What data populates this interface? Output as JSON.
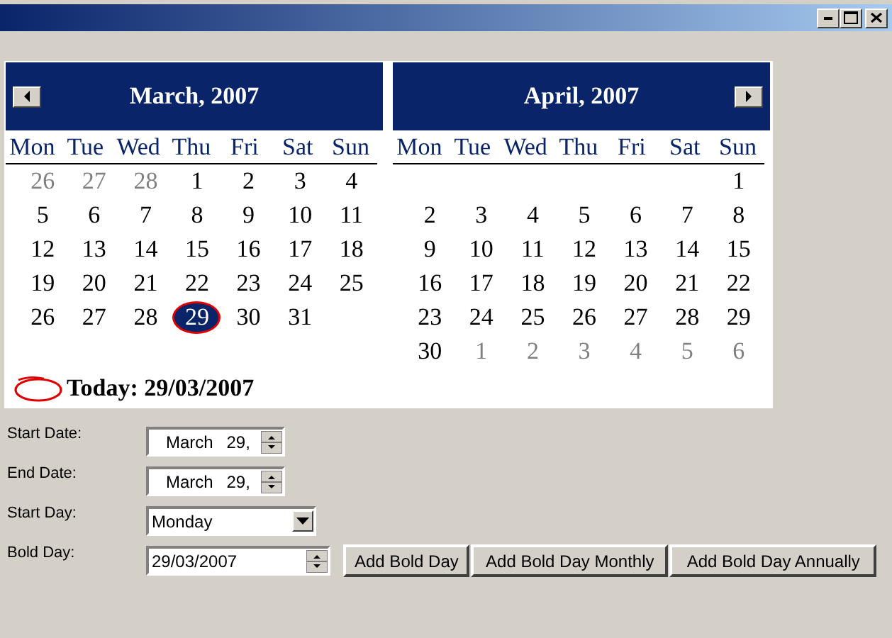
{
  "calendar": {
    "months": [
      {
        "title": "March, 2007",
        "weekdays": [
          "Mon",
          "Tue",
          "Wed",
          "Thu",
          "Fri",
          "Sat",
          "Sun"
        ],
        "weeks": [
          [
            {
              "day": "26",
              "other_month": true,
              "selected": false
            },
            {
              "day": "27",
              "other_month": true,
              "selected": false
            },
            {
              "day": "28",
              "other_month": true,
              "selected": false
            },
            {
              "day": "1",
              "other_month": false,
              "selected": false
            },
            {
              "day": "2",
              "other_month": false,
              "selected": false
            },
            {
              "day": "3",
              "other_month": false,
              "selected": false
            },
            {
              "day": "4",
              "other_month": false,
              "selected": false
            }
          ],
          [
            {
              "day": "5",
              "other_month": false,
              "selected": false
            },
            {
              "day": "6",
              "other_month": false,
              "selected": false
            },
            {
              "day": "7",
              "other_month": false,
              "selected": false
            },
            {
              "day": "8",
              "other_month": false,
              "selected": false
            },
            {
              "day": "9",
              "other_month": false,
              "selected": false
            },
            {
              "day": "10",
              "other_month": false,
              "selected": false
            },
            {
              "day": "11",
              "other_month": false,
              "selected": false
            }
          ],
          [
            {
              "day": "12",
              "other_month": false,
              "selected": false
            },
            {
              "day": "13",
              "other_month": false,
              "selected": false
            },
            {
              "day": "14",
              "other_month": false,
              "selected": false
            },
            {
              "day": "15",
              "other_month": false,
              "selected": false
            },
            {
              "day": "16",
              "other_month": false,
              "selected": false
            },
            {
              "day": "17",
              "other_month": false,
              "selected": false
            },
            {
              "day": "18",
              "other_month": false,
              "selected": false
            }
          ],
          [
            {
              "day": "19",
              "other_month": false,
              "selected": false
            },
            {
              "day": "20",
              "other_month": false,
              "selected": false
            },
            {
              "day": "21",
              "other_month": false,
              "selected": false
            },
            {
              "day": "22",
              "other_month": false,
              "selected": false
            },
            {
              "day": "23",
              "other_month": false,
              "selected": false
            },
            {
              "day": "24",
              "other_month": false,
              "selected": false
            },
            {
              "day": "25",
              "other_month": false,
              "selected": false
            }
          ],
          [
            {
              "day": "26",
              "other_month": false,
              "selected": false
            },
            {
              "day": "27",
              "other_month": false,
              "selected": false
            },
            {
              "day": "28",
              "other_month": false,
              "selected": false
            },
            {
              "day": "29",
              "other_month": false,
              "selected": true
            },
            {
              "day": "30",
              "other_month": false,
              "selected": false
            },
            {
              "day": "31",
              "other_month": false,
              "selected": false
            }
          ]
        ]
      },
      {
        "title": "April, 2007",
        "weekdays": [
          "Mon",
          "Tue",
          "Wed",
          "Thu",
          "Fri",
          "Sat",
          "Sun"
        ],
        "weeks": [
          [
            {
              "day": "1",
              "other_month": false,
              "selected": false
            }
          ],
          [
            {
              "day": "2",
              "other_month": false,
              "selected": false
            },
            {
              "day": "3",
              "other_month": false,
              "selected": false
            },
            {
              "day": "4",
              "other_month": false,
              "selected": false
            },
            {
              "day": "5",
              "other_month": false,
              "selected": false
            },
            {
              "day": "6",
              "other_month": false,
              "selected": false
            },
            {
              "day": "7",
              "other_month": false,
              "selected": false
            },
            {
              "day": "8",
              "other_month": false,
              "selected": false
            }
          ],
          [
            {
              "day": "9",
              "other_month": false,
              "selected": false
            },
            {
              "day": "10",
              "other_month": false,
              "selected": false
            },
            {
              "day": "11",
              "other_month": false,
              "selected": false
            },
            {
              "day": "12",
              "other_month": false,
              "selected": false
            },
            {
              "day": "13",
              "other_month": false,
              "selected": false
            },
            {
              "day": "14",
              "other_month": false,
              "selected": false
            },
            {
              "day": "15",
              "other_month": false,
              "selected": false
            }
          ],
          [
            {
              "day": "16",
              "other_month": false,
              "selected": false
            },
            {
              "day": "17",
              "other_month": false,
              "selected": false
            },
            {
              "day": "18",
              "other_month": false,
              "selected": false
            },
            {
              "day": "19",
              "other_month": false,
              "selected": false
            },
            {
              "day": "20",
              "other_month": false,
              "selected": false
            },
            {
              "day": "21",
              "other_month": false,
              "selected": false
            },
            {
              "day": "22",
              "other_month": false,
              "selected": false
            }
          ],
          [
            {
              "day": "23",
              "other_month": false,
              "selected": false
            },
            {
              "day": "24",
              "other_month": false,
              "selected": false
            },
            {
              "day": "25",
              "other_month": false,
              "selected": false
            },
            {
              "day": "26",
              "other_month": false,
              "selected": false
            },
            {
              "day": "27",
              "other_month": false,
              "selected": false
            },
            {
              "day": "28",
              "other_month": false,
              "selected": false
            },
            {
              "day": "29",
              "other_month": false,
              "selected": false
            }
          ],
          [
            {
              "day": "30",
              "other_month": false,
              "selected": false
            },
            {
              "day": "1",
              "other_month": true,
              "selected": false
            },
            {
              "day": "2",
              "other_month": true,
              "selected": false
            },
            {
              "day": "3",
              "other_month": true,
              "selected": false
            },
            {
              "day": "4",
              "other_month": true,
              "selected": false
            },
            {
              "day": "5",
              "other_month": true,
              "selected": false
            },
            {
              "day": "6",
              "other_month": true,
              "selected": false
            }
          ]
        ]
      }
    ],
    "today": "Today: 29/03/2007"
  },
  "form": [
    {
      "kind": "date",
      "label": "Start Date:",
      "month": "March",
      "day": "29,"
    },
    {
      "kind": "date",
      "label": "End Date:",
      "month": "March",
      "day": "29,"
    },
    {
      "kind": "dropdown",
      "label": "Start Day:",
      "value": "Monday"
    },
    {
      "kind": "spin",
      "label": "Bold Day:",
      "value": "29/03/2007"
    }
  ],
  "buttons": [
    "Add Bold Day",
    "Add Bold Day Monthly",
    "Add Bold Day Annually"
  ]
}
